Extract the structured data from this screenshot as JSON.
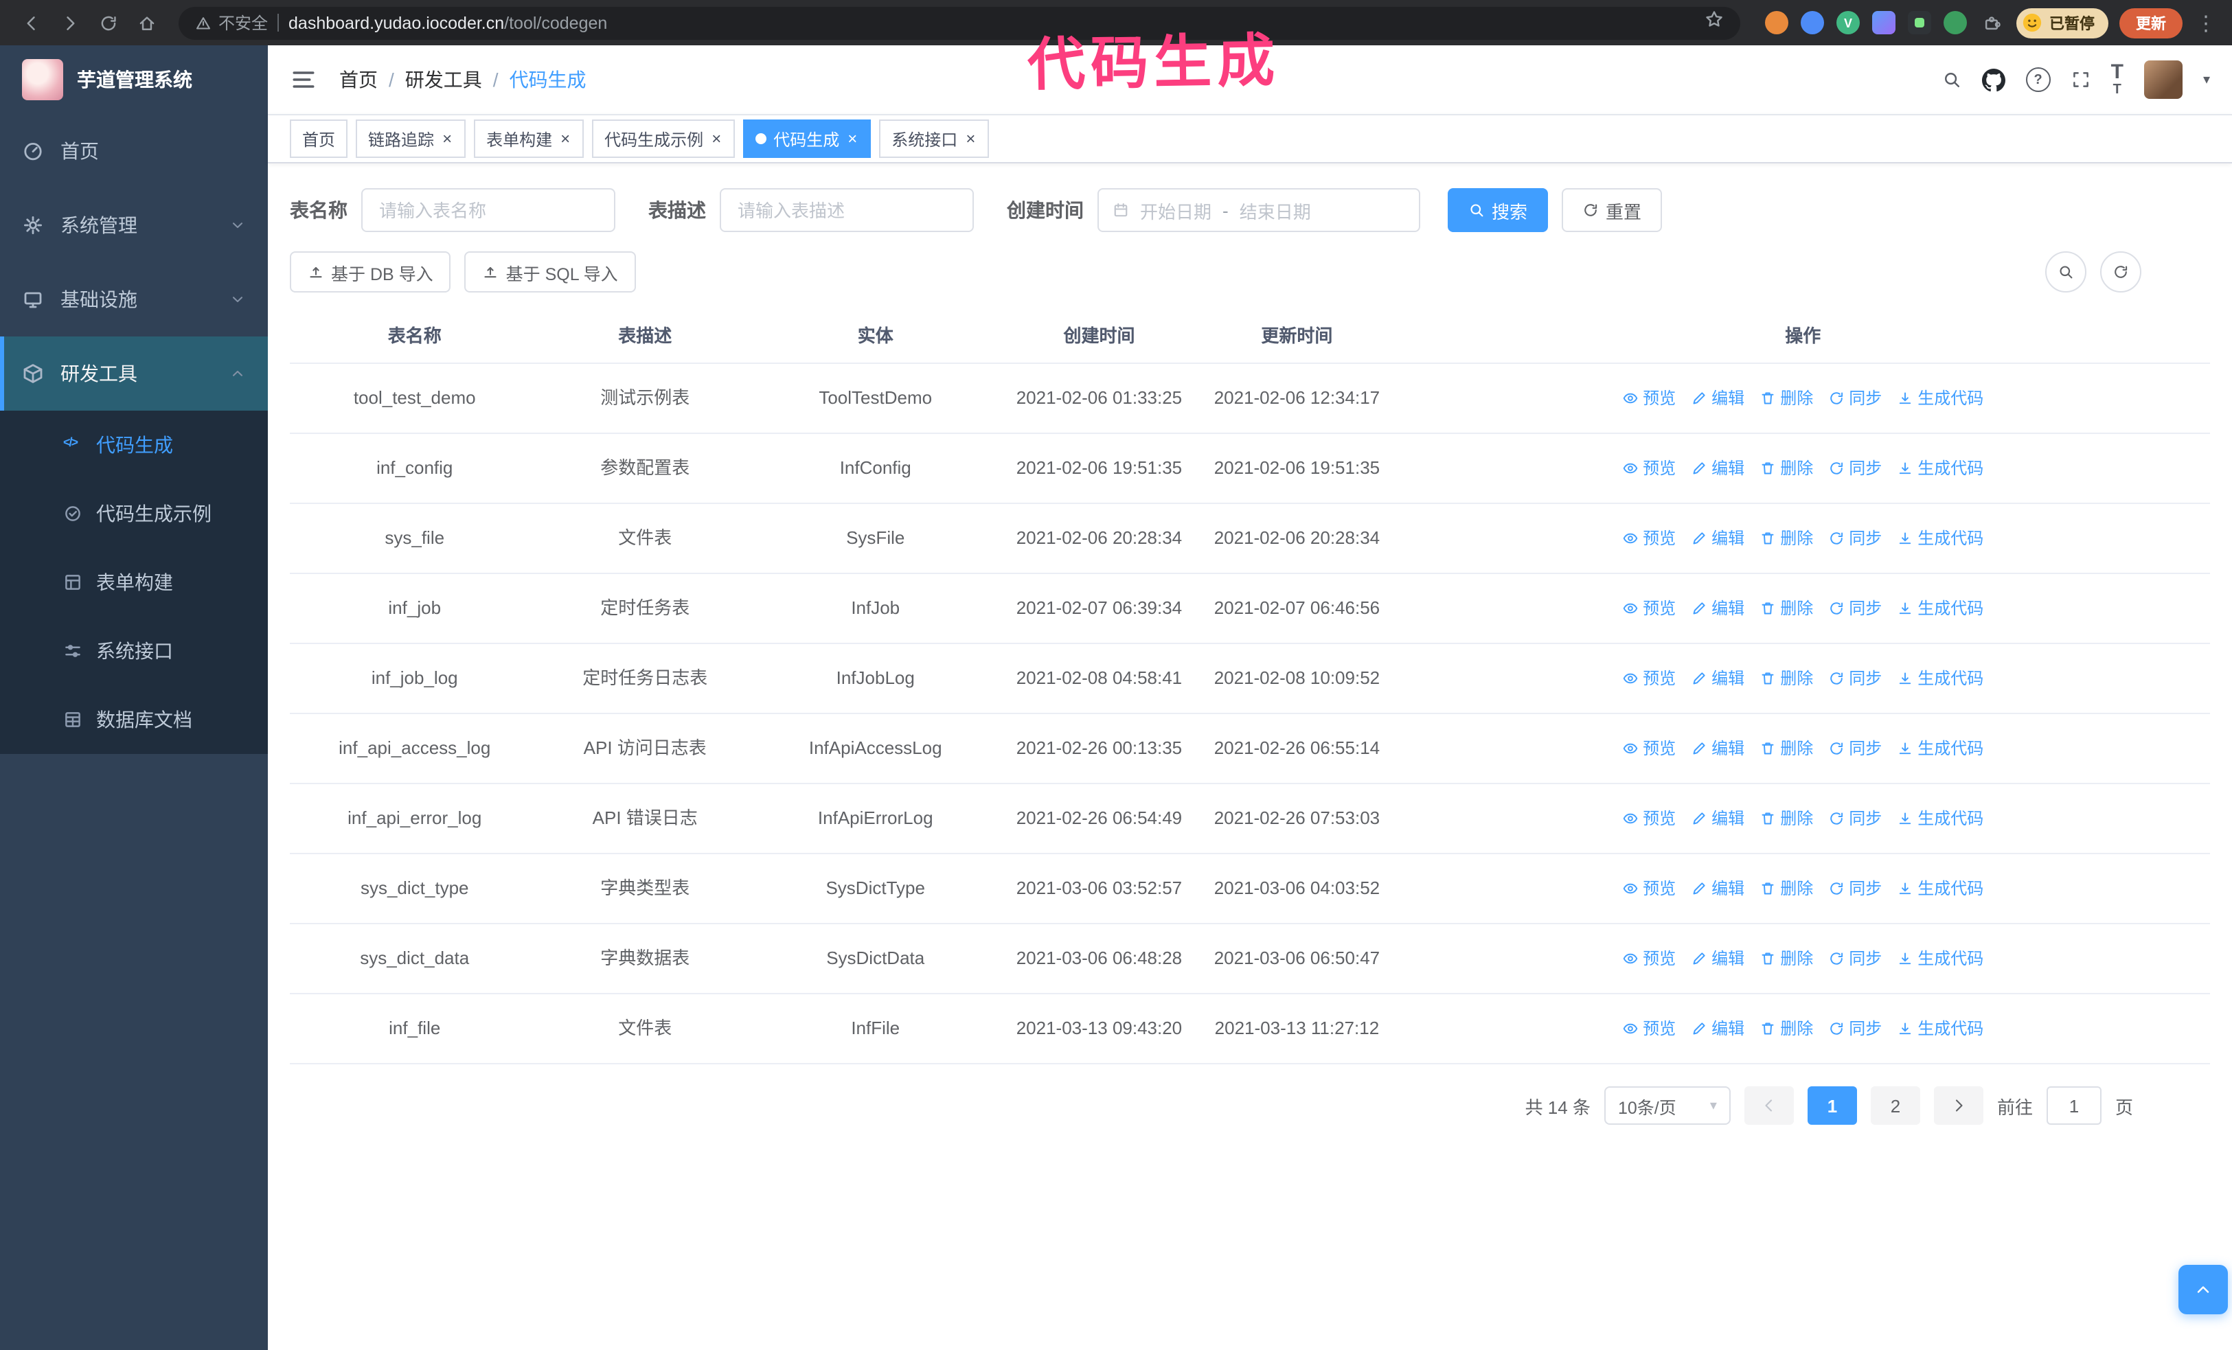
{
  "annotation": {
    "text": "代码生成"
  },
  "browser": {
    "security_label": "不安全",
    "url": {
      "host": "dashboard.yudao.iocoder.cn",
      "path": "/tool/codegen"
    },
    "paused_badge": "已暂停",
    "update_button": "更新"
  },
  "sidebar": {
    "logo_title": "芋道管理系统",
    "menu": [
      {
        "label": "首页",
        "icon": "dashboard-icon"
      },
      {
        "label": "系统管理",
        "icon": "gear-icon",
        "expandable": true
      },
      {
        "label": "基础设施",
        "icon": "monitor-icon",
        "expandable": true
      },
      {
        "label": "研发工具",
        "icon": "toolbox-icon",
        "expandable": true,
        "expanded": true
      }
    ],
    "submenu": [
      {
        "label": "代码生成",
        "icon": "code-icon",
        "active": true
      },
      {
        "label": "代码生成示例",
        "icon": "badge-check-icon"
      },
      {
        "label": "表单构建",
        "icon": "form-grid-icon"
      },
      {
        "label": "系统接口",
        "icon": "sliders-icon"
      },
      {
        "label": "数据库文档",
        "icon": "table-grid-icon"
      }
    ]
  },
  "header": {
    "breadcrumb": [
      {
        "label": "首页"
      },
      {
        "label": "研发工具"
      },
      {
        "label": "代码生成",
        "current": true
      }
    ]
  },
  "tabs": [
    {
      "label": "首页",
      "pinned": true
    },
    {
      "label": "链路追踪"
    },
    {
      "label": "表单构建"
    },
    {
      "label": "代码生成示例"
    },
    {
      "label": "代码生成",
      "active": true
    },
    {
      "label": "系统接口"
    }
  ],
  "filters": {
    "table_name_label": "表名称",
    "table_name_placeholder": "请输入表名称",
    "table_desc_label": "表描述",
    "table_desc_placeholder": "请输入表描述",
    "create_time_label": "创建时间",
    "date_start_placeholder": "开始日期",
    "date_separator": "-",
    "date_end_placeholder": "结束日期",
    "search_button": "搜索",
    "reset_button": "重置"
  },
  "toolbar": {
    "import_db_button": "基于 DB 导入",
    "import_sql_button": "基于 SQL 导入"
  },
  "table": {
    "headers": [
      "表名称",
      "表描述",
      "实体",
      "创建时间",
      "更新时间",
      "操作"
    ],
    "action_labels": [
      "预览",
      "编辑",
      "删除",
      "同步",
      "生成代码"
    ],
    "rows": [
      {
        "name": "tool_test_demo",
        "desc": "测试示例表",
        "entity": "ToolTestDemo",
        "created": "2021-02-06 01:33:25",
        "updated": "2021-02-06 12:34:17"
      },
      {
        "name": "inf_config",
        "desc": "参数配置表",
        "entity": "InfConfig",
        "created": "2021-02-06 19:51:35",
        "updated": "2021-02-06 19:51:35"
      },
      {
        "name": "sys_file",
        "desc": "文件表",
        "entity": "SysFile",
        "created": "2021-02-06 20:28:34",
        "updated": "2021-02-06 20:28:34"
      },
      {
        "name": "inf_job",
        "desc": "定时任务表",
        "entity": "InfJob",
        "created": "2021-02-07 06:39:34",
        "updated": "2021-02-07 06:46:56"
      },
      {
        "name": "inf_job_log",
        "desc": "定时任务日志表",
        "entity": "InfJobLog",
        "created": "2021-02-08 04:58:41",
        "updated": "2021-02-08 10:09:52"
      },
      {
        "name": "inf_api_access_log",
        "desc": "API 访问日志表",
        "entity": "InfApiAccessLog",
        "created": "2021-02-26 00:13:35",
        "updated": "2021-02-26 06:55:14"
      },
      {
        "name": "inf_api_error_log",
        "desc": "API 错误日志",
        "entity": "InfApiErrorLog",
        "created": "2021-02-26 06:54:49",
        "updated": "2021-02-26 07:53:03"
      },
      {
        "name": "sys_dict_type",
        "desc": "字典类型表",
        "entity": "SysDictType",
        "created": "2021-03-06 03:52:57",
        "updated": "2021-03-06 04:03:52"
      },
      {
        "name": "sys_dict_data",
        "desc": "字典数据表",
        "entity": "SysDictData",
        "created": "2021-03-06 06:48:28",
        "updated": "2021-03-06 06:50:47"
      },
      {
        "name": "inf_file",
        "desc": "文件表",
        "entity": "InfFile",
        "created": "2021-03-13 09:43:20",
        "updated": "2021-03-13 11:27:12"
      }
    ]
  },
  "pagination": {
    "total_text": "共 14 条",
    "page_size": "10条/页",
    "pages": [
      "1",
      "2"
    ],
    "active_page": "1",
    "goto_prefix": "前往",
    "goto_value": "1",
    "goto_suffix": "页"
  },
  "glyphs": {
    "close": "×",
    "caret_down": "▾",
    "kebab": "⋮",
    "breadcrumb_separator": "/",
    "letter_t": "T",
    "code_brackets": "</>"
  },
  "colors": {
    "accent": "#409EFF",
    "sidebar_bg": "#304156",
    "submenu_bg": "#1F2D3D",
    "tab_active_bg": "#409EFF",
    "annotation": "#FC3E7F",
    "update_button_bg": "#D9603C"
  }
}
